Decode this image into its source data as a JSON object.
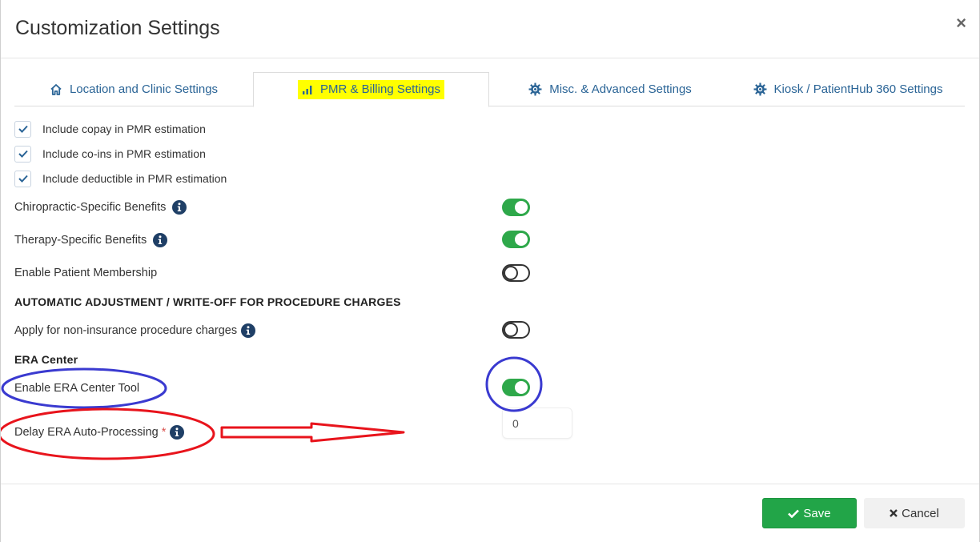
{
  "dialog": {
    "title": "Customization Settings",
    "close_glyph": "×"
  },
  "tabs": [
    {
      "label": "Location and Clinic Settings",
      "icon": "home-icon",
      "active": false
    },
    {
      "label": "PMR & Billing Settings",
      "icon": "bar-chart-icon",
      "active": true
    },
    {
      "label": "Misc. & Advanced Settings",
      "icon": "gear-icon",
      "active": false
    },
    {
      "label": "Kiosk / PatientHub 360 Settings",
      "icon": "gear-icon",
      "active": false
    }
  ],
  "checkboxes": [
    {
      "label": "Include copay in PMR estimation",
      "checked": true
    },
    {
      "label": "Include co-ins in PMR estimation",
      "checked": true
    },
    {
      "label": "Include deductible in PMR estimation",
      "checked": true
    }
  ],
  "settings": {
    "chiropractic": {
      "label": "Chiropractic-Specific Benefits",
      "enabled": true
    },
    "therapy": {
      "label": "Therapy-Specific Benefits",
      "enabled": true
    },
    "membership": {
      "label": "Enable Patient Membership",
      "enabled": false
    },
    "adjustment_section": "AUTOMATIC ADJUSTMENT / WRITE-OFF FOR PROCEDURE CHARGES",
    "non_insurance": {
      "label": "Apply for non-insurance procedure charges",
      "enabled": false
    },
    "era_section": "ERA Center",
    "era_tool": {
      "label": "Enable ERA Center Tool",
      "enabled": true
    },
    "era_delay": {
      "label": "Delay ERA Auto-Processing",
      "required_mark": "*",
      "value": "0"
    }
  },
  "footer": {
    "save_label": "Save",
    "cancel_label": "Cancel"
  },
  "colors": {
    "accent_link": "#2a6496",
    "toggle_on": "#2ea84a",
    "save_button": "#22a548",
    "highlight": "#ffff00",
    "annotation_blue": "#3a3ad0",
    "annotation_red": "#e8141c"
  }
}
